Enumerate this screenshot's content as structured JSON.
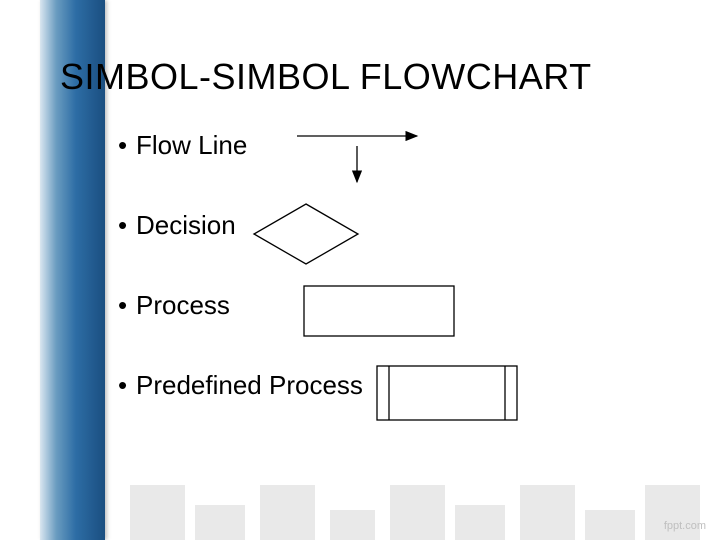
{
  "title": "SIMBOL-SIMBOL FLOWCHART",
  "bullets": {
    "flow_line": "Flow Line",
    "decision": "Decision",
    "process": "Process",
    "predefined_process": "Predefined Process"
  },
  "watermark": "fppt.com"
}
